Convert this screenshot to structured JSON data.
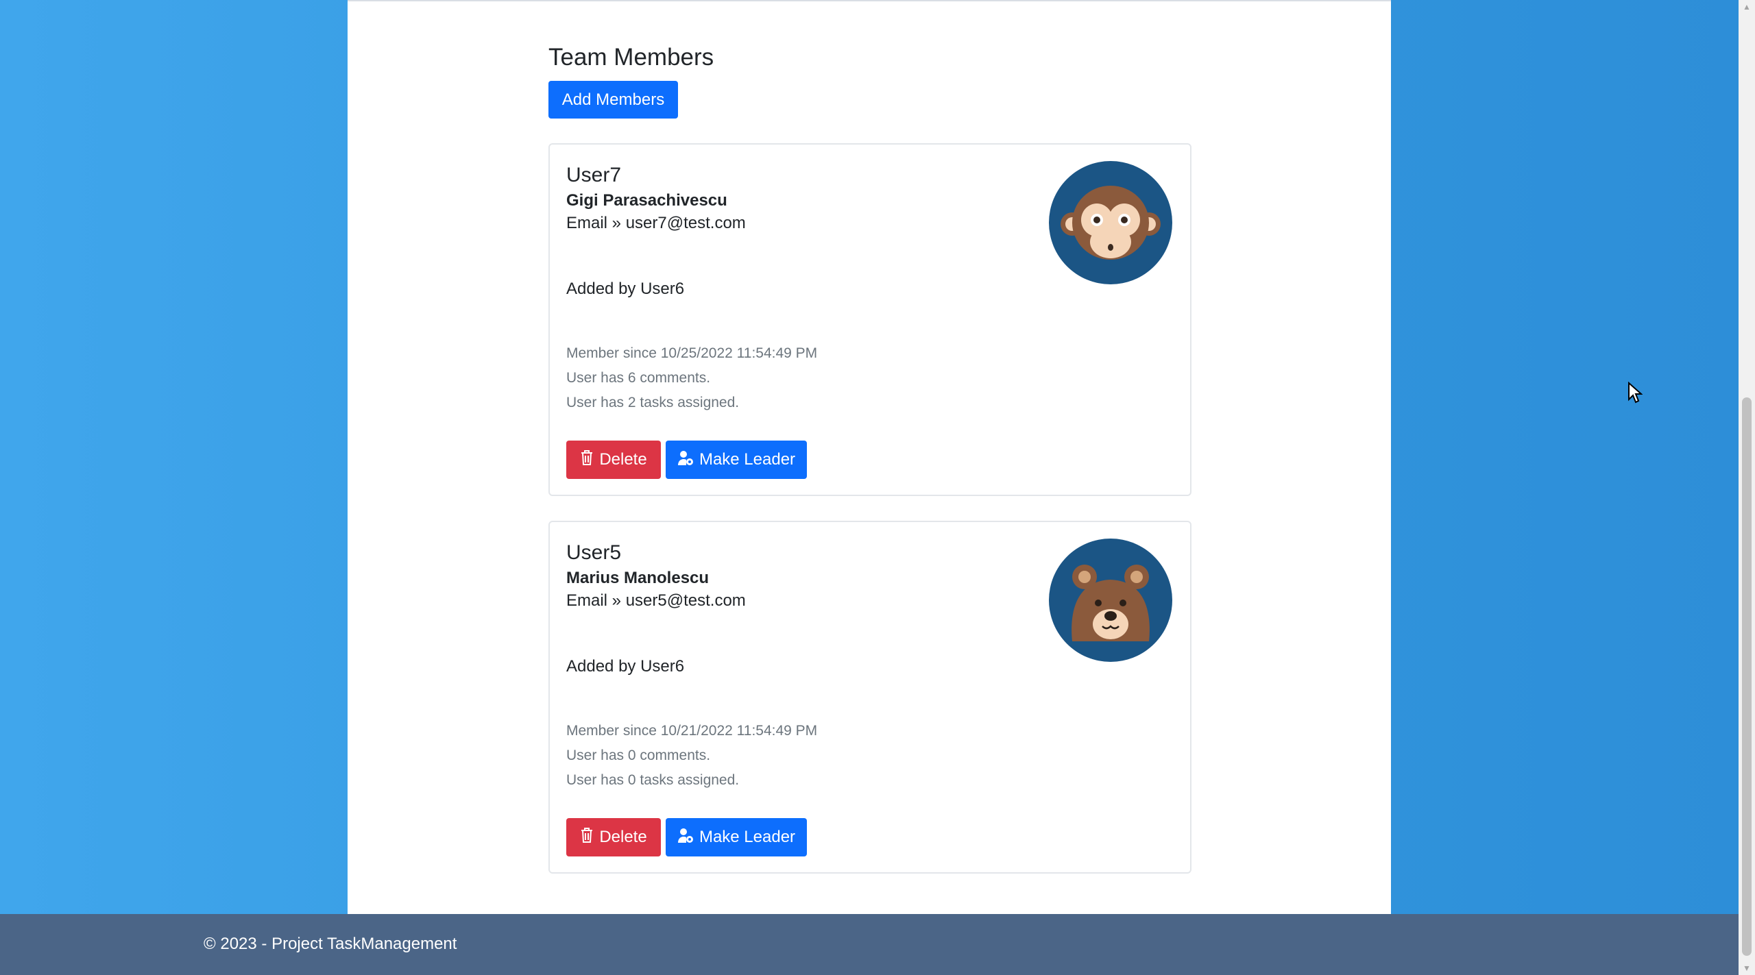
{
  "page": {
    "title": "Team Members",
    "add_button_label": "Add Members"
  },
  "members": [
    {
      "username": "User7",
      "full_name": "Gigi Parasachivescu",
      "email": "Email » user7@test.com",
      "added_by": "Added by User6",
      "member_since": "Member since 10/25/2022 11:54:49 PM",
      "comments": "User has 6 comments.",
      "tasks": "User has 2 tasks assigned.",
      "avatar_icon": "monkey-avatar",
      "delete_label": "Delete",
      "make_leader_label": "Make Leader"
    },
    {
      "username": "User5",
      "full_name": "Marius Manolescu",
      "email": "Email » user5@test.com",
      "added_by": "Added by User6",
      "member_since": "Member since 10/21/2022 11:54:49 PM",
      "comments": "User has 0 comments.",
      "tasks": "User has 0 tasks assigned.",
      "avatar_icon": "bear-avatar",
      "delete_label": "Delete",
      "make_leader_label": "Make Leader"
    }
  ],
  "footer": {
    "copyright": "© 2023 - Project TaskManagement"
  },
  "colors": {
    "primary": "#0d6efd",
    "danger": "#dc3545",
    "footer_bg": "#4b6587",
    "background": "#3398df",
    "avatar_bg": "#1b5585"
  }
}
